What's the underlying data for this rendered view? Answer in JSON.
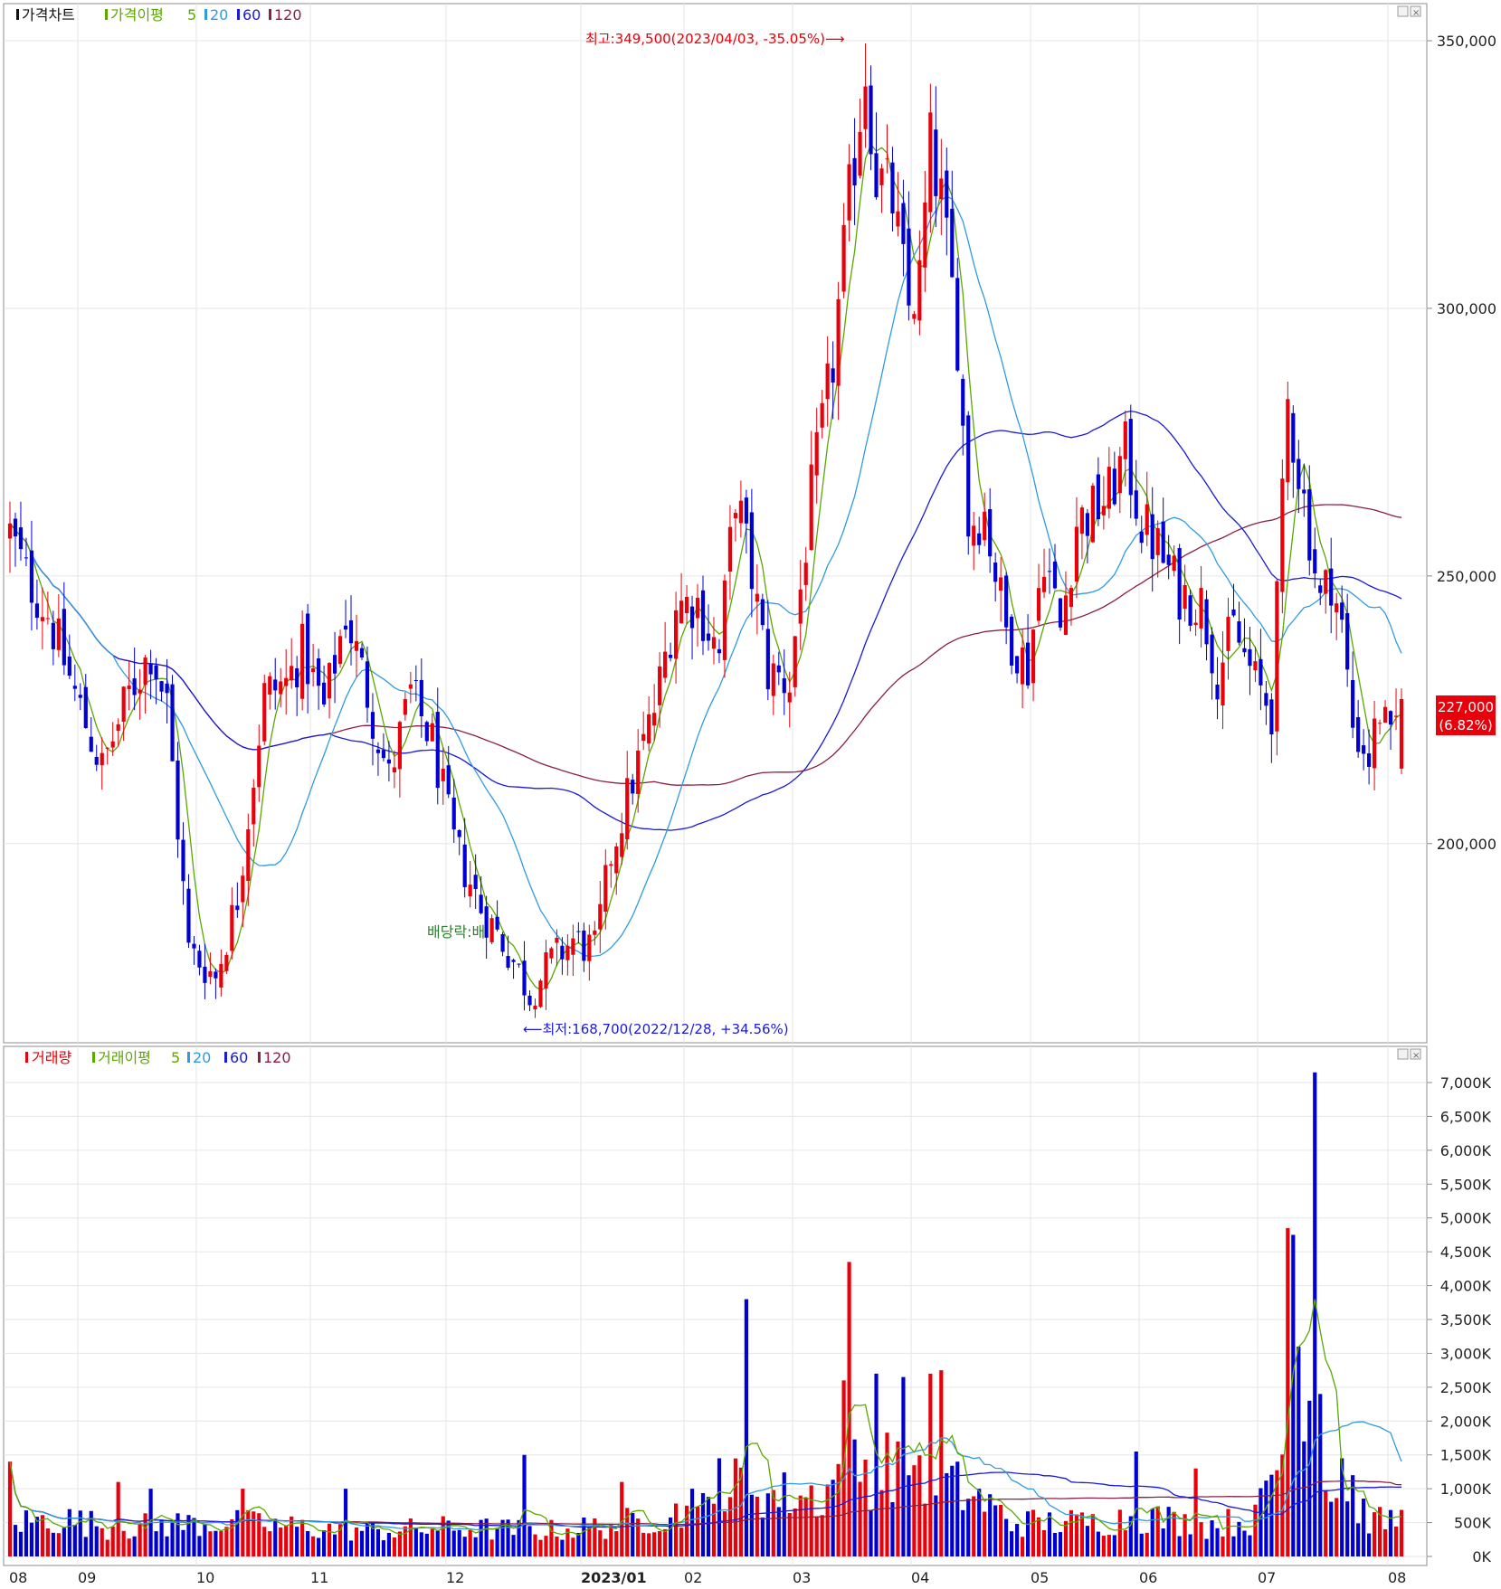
{
  "price_panel": {
    "legend": [
      "가격차트",
      "가격이평",
      "5",
      "20",
      "60",
      "120"
    ],
    "y_ticks": [
      "350,000",
      "300,000",
      "250,000",
      "200,000"
    ],
    "annotations": {
      "high": "최고:349,500(2023/04/03, -35.05%)⟶",
      "low": "⟵최저:168,700(2022/12/28, +34.56%)",
      "dividend": "배당락:배"
    },
    "current": {
      "price": "227,000",
      "change": "(6.82%)"
    }
  },
  "volume_panel": {
    "legend": [
      "거래량",
      "거래이평",
      "5",
      "20",
      "60",
      "120"
    ],
    "y_ticks": [
      "7,000K",
      "6,500K",
      "6,000K",
      "5,500K",
      "5,000K",
      "4,500K",
      "4,000K",
      "3,500K",
      "3,000K",
      "2,500K",
      "2,000K",
      "1,500K",
      "1,000K",
      "500K",
      "0K"
    ]
  },
  "x_labels": [
    "08",
    "09",
    "10",
    "11",
    "12",
    "2023/01",
    "02",
    "03",
    "04",
    "05",
    "06",
    "07",
    "08"
  ],
  "colors": {
    "up": "#e8000b",
    "down": "#0000d2",
    "ma5": "#5aa800",
    "ma20": "#2f9be0",
    "ma60": "#1a1ad8",
    "ma120": "#8b2040",
    "grid": "#e6e6e6",
    "border": "#8c8c8c",
    "text": "#333333"
  },
  "chart_data": {
    "type": "candlestick+volume",
    "period": "daily, 2022/08 - 2023/08",
    "ylim_price": [
      168000,
      356000
    ],
    "ylim_volume": [
      0,
      7300
    ],
    "volume_unit": "K",
    "price_high": {
      "value": 349500,
      "date": "2023/04/03",
      "pct": -35.05
    },
    "price_low": {
      "value": 168700,
      "date": "2022/12/28",
      "pct": 34.56
    },
    "last_close": 227000,
    "last_change_pct": 6.82,
    "price_keypoints": [
      [
        0,
        258000
      ],
      [
        3,
        250000
      ],
      [
        7,
        243000
      ],
      [
        12,
        228000
      ],
      [
        17,
        214000
      ],
      [
        22,
        228000
      ],
      [
        26,
        236000
      ],
      [
        29,
        226000
      ],
      [
        33,
        180000
      ],
      [
        38,
        175000
      ],
      [
        42,
        190000
      ],
      [
        47,
        228000
      ],
      [
        51,
        230000
      ],
      [
        54,
        236000
      ],
      [
        58,
        225000
      ],
      [
        62,
        243000
      ],
      [
        65,
        232000
      ],
      [
        70,
        212000
      ],
      [
        74,
        228000
      ],
      [
        78,
        219000
      ],
      [
        82,
        200000
      ],
      [
        87,
        188000
      ],
      [
        92,
        180000
      ],
      [
        96,
        172000
      ],
      [
        100,
        178000
      ],
      [
        104,
        182000
      ],
      [
        108,
        180000
      ],
      [
        111,
        198000
      ],
      [
        115,
        212000
      ],
      [
        119,
        225000
      ],
      [
        123,
        245000
      ],
      [
        127,
        245000
      ],
      [
        131,
        235000
      ],
      [
        134,
        266000
      ],
      [
        137,
        250000
      ],
      [
        140,
        232000
      ],
      [
        144,
        230000
      ],
      [
        148,
        265000
      ],
      [
        152,
        290000
      ],
      [
        155,
        320000
      ],
      [
        158,
        345000
      ],
      [
        160,
        325000
      ],
      [
        163,
        320000
      ],
      [
        166,
        300000
      ],
      [
        168,
        305000
      ],
      [
        170,
        330000
      ],
      [
        172,
        320000
      ],
      [
        175,
        295000
      ],
      [
        177,
        260000
      ],
      [
        180,
        262000
      ],
      [
        184,
        240000
      ],
      [
        188,
        233000
      ],
      [
        191,
        255000
      ],
      [
        194,
        240000
      ],
      [
        197,
        260000
      ],
      [
        200,
        262000
      ],
      [
        203,
        265000
      ],
      [
        206,
        273000
      ],
      [
        209,
        260000
      ],
      [
        212,
        255000
      ],
      [
        216,
        247000
      ],
      [
        220,
        245000
      ],
      [
        223,
        232000
      ],
      [
        226,
        240000
      ],
      [
        230,
        230000
      ],
      [
        233,
        225000
      ],
      [
        236,
        282000
      ],
      [
        238,
        270000
      ],
      [
        240,
        258000
      ],
      [
        242,
        245000
      ],
      [
        244,
        250000
      ],
      [
        246,
        240000
      ],
      [
        248,
        222000
      ],
      [
        251,
        216000
      ],
      [
        253,
        225000
      ],
      [
        255,
        218000
      ],
      [
        257,
        227000
      ]
    ],
    "volume_keypoints": [
      [
        0,
        500
      ],
      [
        10,
        550
      ],
      [
        20,
        420
      ],
      [
        30,
        480
      ],
      [
        40,
        500
      ],
      [
        50,
        450
      ],
      [
        60,
        400
      ],
      [
        70,
        380
      ],
      [
        80,
        420
      ],
      [
        90,
        400
      ],
      [
        100,
        380
      ],
      [
        110,
        450
      ],
      [
        120,
        600
      ],
      [
        130,
        700
      ],
      [
        136,
        1200
      ],
      [
        140,
        900
      ],
      [
        150,
        900
      ],
      [
        155,
        1400
      ],
      [
        160,
        1200
      ],
      [
        165,
        1600
      ],
      [
        170,
        1200
      ],
      [
        175,
        1000
      ],
      [
        180,
        800
      ],
      [
        185,
        500
      ],
      [
        190,
        500
      ],
      [
        200,
        500
      ],
      [
        210,
        600
      ],
      [
        220,
        450
      ],
      [
        230,
        550
      ],
      [
        236,
        1800
      ],
      [
        240,
        2600
      ],
      [
        244,
        900
      ],
      [
        248,
        800
      ],
      [
        252,
        500
      ],
      [
        257,
        550
      ]
    ],
    "volume_spikes": [
      [
        0,
        1400
      ],
      [
        20,
        1100
      ],
      [
        26,
        1000
      ],
      [
        43,
        1000
      ],
      [
        62,
        1000
      ],
      [
        95,
        1500
      ],
      [
        113,
        1100
      ],
      [
        126,
        1000
      ],
      [
        131,
        1450
      ],
      [
        136,
        3800
      ],
      [
        154,
        2600
      ],
      [
        155,
        4350
      ],
      [
        160,
        2700
      ],
      [
        165,
        2650
      ],
      [
        170,
        2700
      ],
      [
        172,
        2750
      ],
      [
        208,
        1550
      ],
      [
        219,
        1300
      ],
      [
        236,
        4850
      ],
      [
        237,
        4750
      ],
      [
        238,
        3100
      ],
      [
        240,
        2300
      ],
      [
        241,
        7150
      ],
      [
        242,
        2400
      ],
      [
        246,
        1450
      ],
      [
        248,
        1200
      ]
    ],
    "ma_series": {
      "price": [
        "5",
        "20",
        "60",
        "120"
      ],
      "volume": [
        "5",
        "20",
        "60",
        "120"
      ]
    }
  }
}
